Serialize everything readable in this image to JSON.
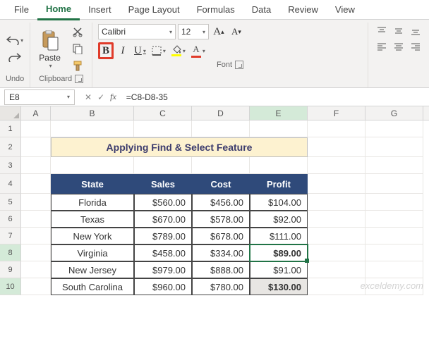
{
  "tabs": {
    "file": "File",
    "home": "Home",
    "insert": "Insert",
    "pagelayout": "Page Layout",
    "formulas": "Formulas",
    "data": "Data",
    "review": "Review",
    "view": "View"
  },
  "groups": {
    "undo": "Undo",
    "clipboard": "Clipboard",
    "font": "Font"
  },
  "clipboard": {
    "paste": "Paste"
  },
  "font": {
    "name": "Calibri",
    "size": "12",
    "bold": "B",
    "italic": "I",
    "underline": "U",
    "grow": "Aˆ",
    "shrink": "Aˇ",
    "fill_color": "#ffff00",
    "text_color": "#e03b2a"
  },
  "namebox": "E8",
  "formula": "=C8-D8-35",
  "cols": {
    "A": "A",
    "B": "B",
    "C": "C",
    "D": "D",
    "E": "E",
    "F": "F",
    "G": "G"
  },
  "rownums": {
    "1": "1",
    "2": "2",
    "3": "3",
    "4": "4",
    "5": "5",
    "6": "6",
    "7": "7",
    "8": "8",
    "9": "9",
    "10": "10"
  },
  "table": {
    "title": "Applying Find & Select Feature",
    "headers": {
      "state": "State",
      "sales": "Sales",
      "cost": "Cost",
      "profit": "Profit"
    },
    "rows": [
      {
        "state": "Florida",
        "sales": "$560.00",
        "cost": "$456.00",
        "profit": "$104.00"
      },
      {
        "state": "Texas",
        "sales": "$670.00",
        "cost": "$578.00",
        "profit": "$92.00"
      },
      {
        "state": "New York",
        "sales": "$789.00",
        "cost": "$678.00",
        "profit": "$111.00"
      },
      {
        "state": "Virginia",
        "sales": "$458.00",
        "cost": "$334.00",
        "profit": "$89.00"
      },
      {
        "state": "New Jersey",
        "sales": "$979.00",
        "cost": "$888.00",
        "profit": "$91.00"
      },
      {
        "state": "South Carolina",
        "sales": "$960.00",
        "cost": "$780.00",
        "profit": "$130.00"
      }
    ]
  },
  "watermark": "exceldemy.com"
}
